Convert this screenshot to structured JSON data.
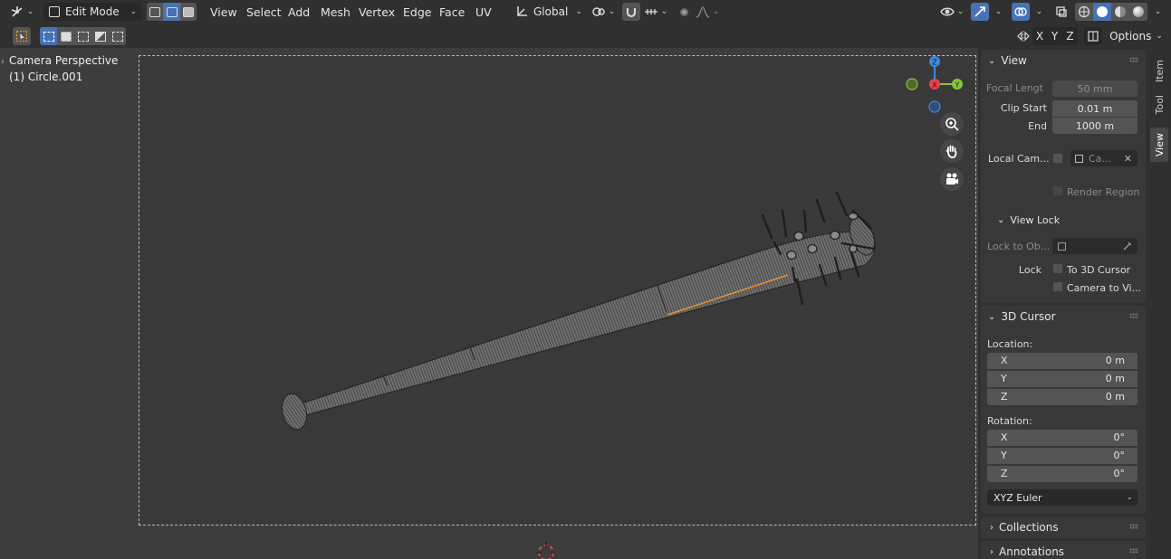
{
  "header": {
    "mode": "Edit Mode",
    "menus": [
      "View",
      "Select",
      "Add",
      "Mesh",
      "Vertex",
      "Edge",
      "Face",
      "UV"
    ],
    "transform_orientation": "Global",
    "options_label": "Options",
    "axis_toggles": [
      "X",
      "Y",
      "Z"
    ]
  },
  "viewport": {
    "title": "Camera Perspective",
    "object": "(1) Circle.001",
    "gizmo": {
      "z": "Z",
      "x": "X",
      "y": "Y"
    }
  },
  "sidebar": {
    "tabs": [
      "Item",
      "Tool",
      "View"
    ],
    "view_panel": {
      "title": "View",
      "focal_length_label": "Focal Lengt",
      "focal_length_value": "50 mm",
      "clip_start_label": "Clip Start",
      "clip_start_value": "0.01 m",
      "end_label": "End",
      "end_value": "1000 m",
      "local_camera_label": "Local Cam...",
      "local_camera_value": "Ca...",
      "render_region_label": "Render Region",
      "view_lock_title": "View Lock",
      "lock_to_object_label": "Lock to Ob...",
      "lock_label": "Lock",
      "to_3d_cursor_label": "To 3D Cursor",
      "camera_to_view_label": "Camera to Vi..."
    },
    "cursor_panel": {
      "title": "3D Cursor",
      "location_label": "Location:",
      "location": [
        {
          "axis": "X",
          "value": "0 m"
        },
        {
          "axis": "Y",
          "value": "0 m"
        },
        {
          "axis": "Z",
          "value": "0 m"
        }
      ],
      "rotation_label": "Rotation:",
      "rotation": [
        {
          "axis": "X",
          "value": "0°"
        },
        {
          "axis": "Y",
          "value": "0°"
        },
        {
          "axis": "Z",
          "value": "0°"
        }
      ],
      "rotation_mode": "XYZ Euler"
    },
    "collections_title": "Collections",
    "annotations_title": "Annotations"
  },
  "colors": {
    "background": "#3d3d3d",
    "header": "#303030",
    "accent_blue": "#4772b3",
    "gizmo_x": "#e8424e",
    "gizmo_y": "#8bc43e",
    "gizmo_z": "#3f8ae0",
    "selection_orange": "#e8902a"
  }
}
